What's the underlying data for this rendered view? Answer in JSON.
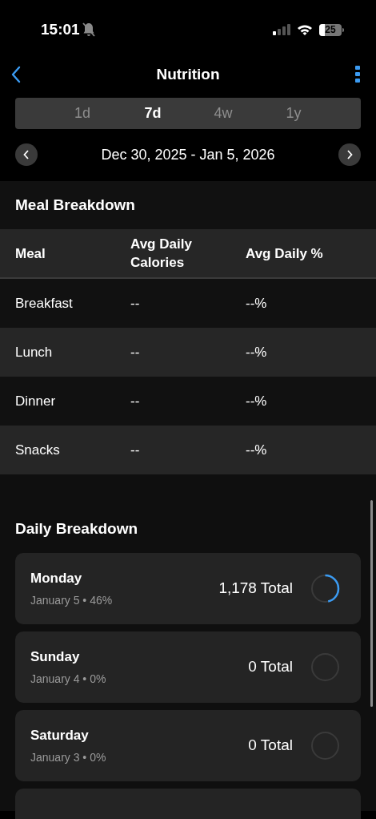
{
  "status_bar": {
    "time": "15:01",
    "battery": "25"
  },
  "nav": {
    "title": "Nutrition"
  },
  "tabs": [
    {
      "label": "1d",
      "selected": false
    },
    {
      "label": "7d",
      "selected": true
    },
    {
      "label": "4w",
      "selected": false
    },
    {
      "label": "1y",
      "selected": false
    }
  ],
  "date_range": "Dec 30, 2025 - Jan 5, 2026",
  "meal_breakdown": {
    "title": "Meal Breakdown",
    "columns": [
      "Meal",
      "Avg Daily Calories",
      "Avg Daily %"
    ],
    "rows": [
      [
        "Breakfast",
        "--",
        "--%"
      ],
      [
        "Lunch",
        "--",
        "--%"
      ],
      [
        "Dinner",
        "--",
        "--%"
      ],
      [
        "Snacks",
        "--",
        "--%"
      ]
    ]
  },
  "daily_breakdown": {
    "title": "Daily Breakdown",
    "days": [
      {
        "day": "Monday",
        "detail": "January 5 • 46%",
        "total": "1,178 Total",
        "kind": "progress"
      },
      {
        "day": "Sunday",
        "detail": "January 4 • 0%",
        "total": "0 Total",
        "kind": "empty"
      },
      {
        "day": "Saturday",
        "detail": "January 3 • 0%",
        "total": "0 Total",
        "kind": "empty"
      }
    ]
  }
}
